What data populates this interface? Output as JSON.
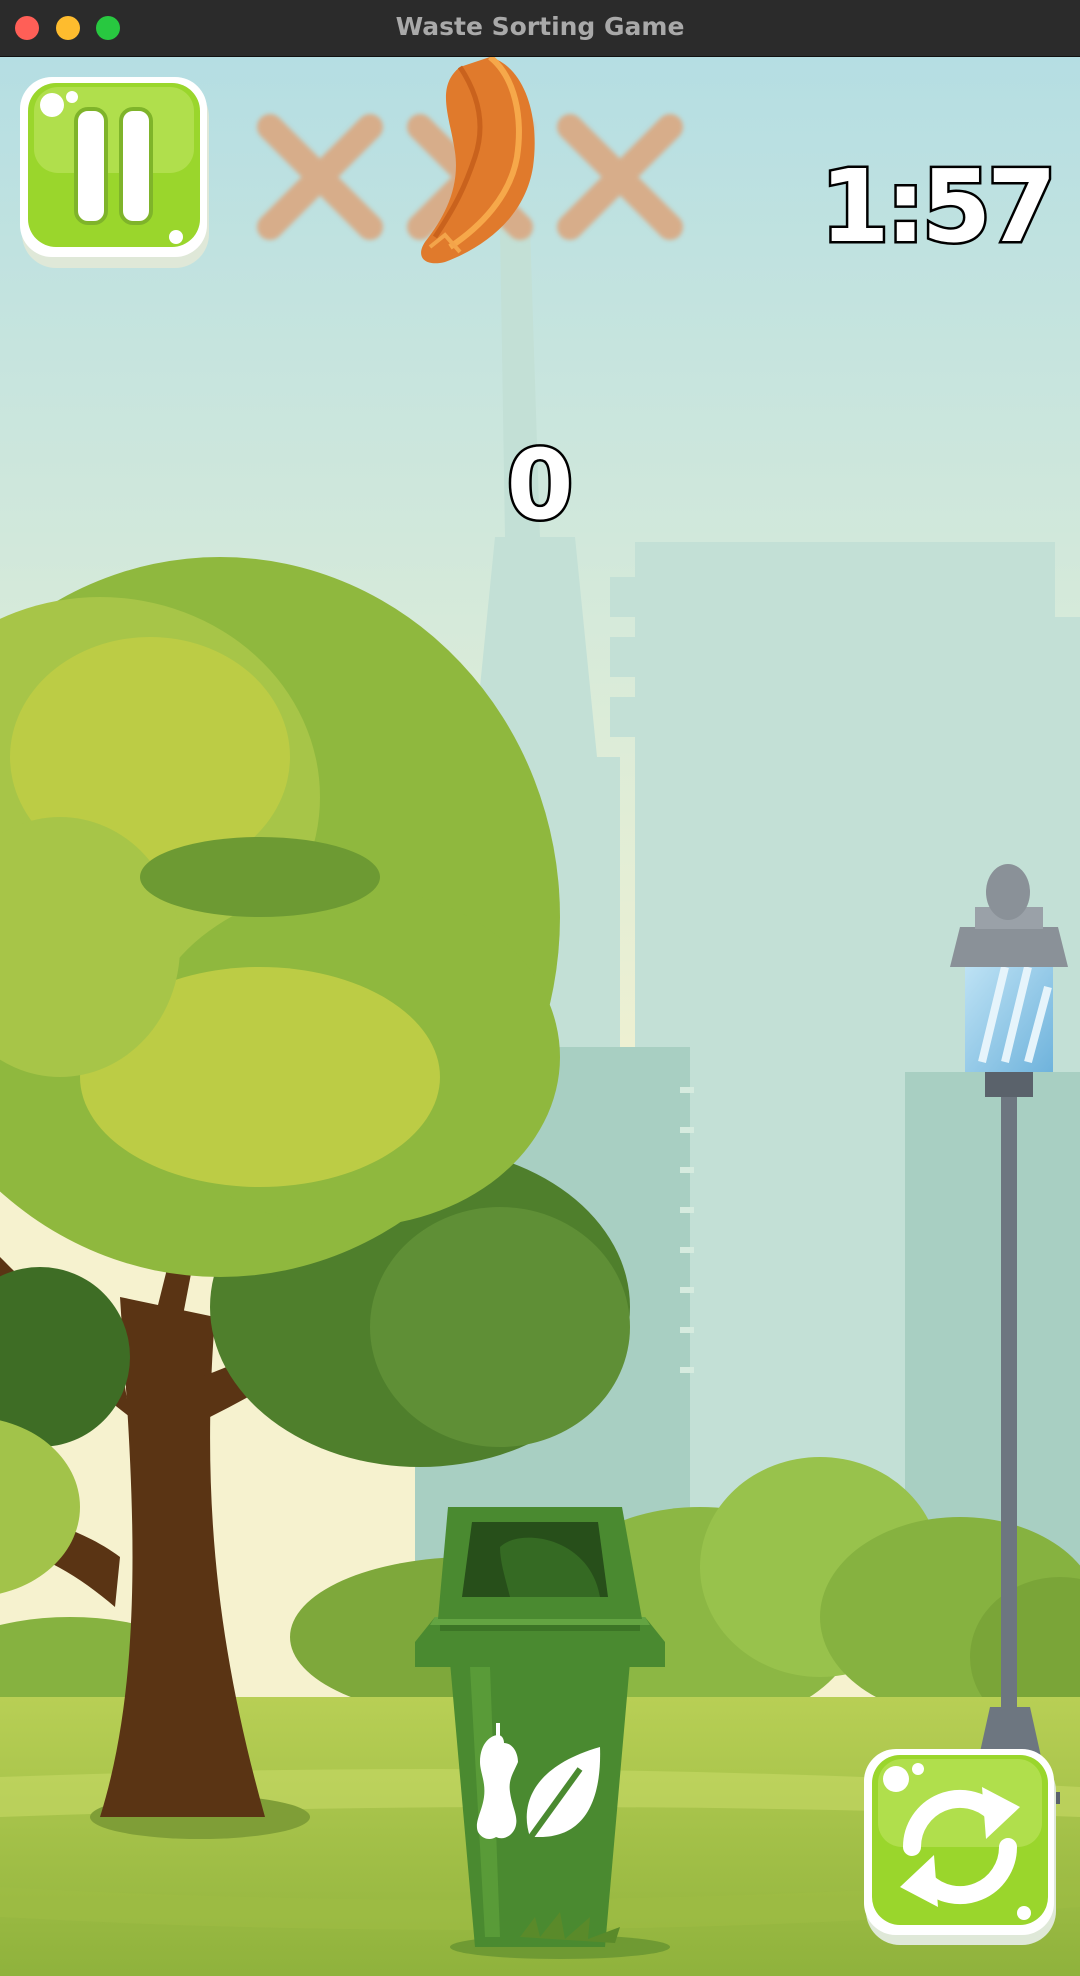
{
  "window": {
    "title": "Waste Sorting Game"
  },
  "hud": {
    "timer": "1:57",
    "score": "0",
    "lives": {
      "total": 3,
      "lost": 0
    },
    "pause_icon": "pause-icon",
    "restart_icon": "restart-icon"
  },
  "falling_item": {
    "type": "orange-peel",
    "icon": "orange-peel-icon"
  },
  "bin": {
    "type": "organic",
    "icons": [
      "apple-core-icon",
      "leaf-icon"
    ],
    "color": "#4a8a30"
  },
  "colors": {
    "button_green": "#9ad62c",
    "sky_top": "#b7dfe2",
    "sky_bottom": "#f6f3d0",
    "grass": "#a6c64a"
  }
}
